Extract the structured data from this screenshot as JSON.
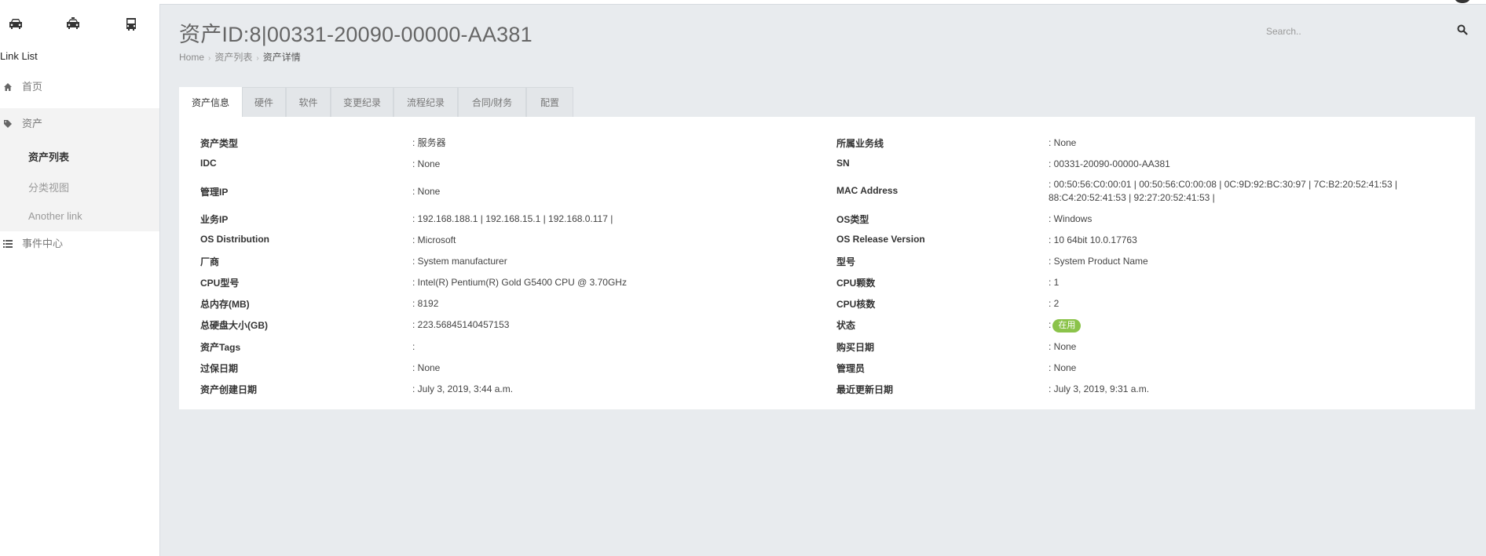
{
  "sidebar": {
    "top_icons": [
      "car-icon",
      "taxi-icon",
      "bus-icon"
    ],
    "title": "Link List",
    "nav": [
      {
        "label": "首页",
        "icon": "home-icon"
      },
      {
        "label": "资产",
        "icon": "tag-icon"
      },
      {
        "label": "事件中心",
        "icon": "list-icon"
      }
    ],
    "submenu": [
      {
        "label": "资产列表",
        "active": true
      },
      {
        "label": "分类视图",
        "active": false
      },
      {
        "label": "Another link",
        "active": false
      }
    ]
  },
  "header": {
    "title": "资产ID:8|00331-20090-00000-AA381",
    "breadcrumb": [
      "Home",
      "资产列表",
      "资产详情"
    ],
    "search_placeholder": "Search.."
  },
  "tabs": [
    "资产信息",
    "硬件",
    "软件",
    "变更纪录",
    "流程纪录",
    "合同/财务",
    "配置"
  ],
  "active_tab": "资产信息",
  "colors": {
    "status_green": "#8bc34a",
    "background": "#e8ebee"
  },
  "details": {
    "left": [
      {
        "label": "资产类型",
        "value": ": 服务器"
      },
      {
        "label": "IDC",
        "value": ": None"
      },
      {
        "label": "管理IP",
        "value": ": None"
      },
      {
        "label": "业务IP",
        "value": ": 192.168.188.1 | 192.168.15.1 | 192.168.0.117 |"
      },
      {
        "label": "OS Distribution",
        "value": ": Microsoft"
      },
      {
        "label": "厂商",
        "value": ": System manufacturer"
      },
      {
        "label": "CPU型号",
        "value": ": Intel(R) Pentium(R) Gold G5400 CPU @ 3.70GHz"
      },
      {
        "label": "总内存(MB)",
        "value": ": 8192"
      },
      {
        "label": "总硬盘大小(GB)",
        "value": ": 223.56845140457153"
      },
      {
        "label": "资产Tags",
        "value": ":"
      },
      {
        "label": "过保日期",
        "value": ": None"
      },
      {
        "label": "资产创建日期",
        "value": ": July 3, 2019, 3:44 a.m."
      }
    ],
    "right": [
      {
        "label": "所属业务线",
        "value": ": None"
      },
      {
        "label": "SN",
        "value": ": 00331-20090-00000-AA381"
      },
      {
        "label": "MAC Address",
        "value": ": 00:50:56:C0:00:01 | 00:50:56:C0:00:08 | 0C:9D:92:BC:30:97 | 7C:B2:20:52:41:53 | 88:C4:20:52:41:53 | 92:27:20:52:41:53 |"
      },
      {
        "label": "OS类型",
        "value": ": Windows"
      },
      {
        "label": "OS Release Version",
        "value": ": 10 64bit 10.0.17763"
      },
      {
        "label": "型号",
        "value": ": System Product Name"
      },
      {
        "label": "CPU颗数",
        "value": ": 1"
      },
      {
        "label": "CPU核数",
        "value": ": 2"
      },
      {
        "label": "状态",
        "value": ":",
        "badge": "在用"
      },
      {
        "label": "购买日期",
        "value": ": None"
      },
      {
        "label": "管理员",
        "value": ": None"
      },
      {
        "label": "最近更新日期",
        "value": ": July 3, 2019, 9:31 a.m."
      }
    ]
  }
}
